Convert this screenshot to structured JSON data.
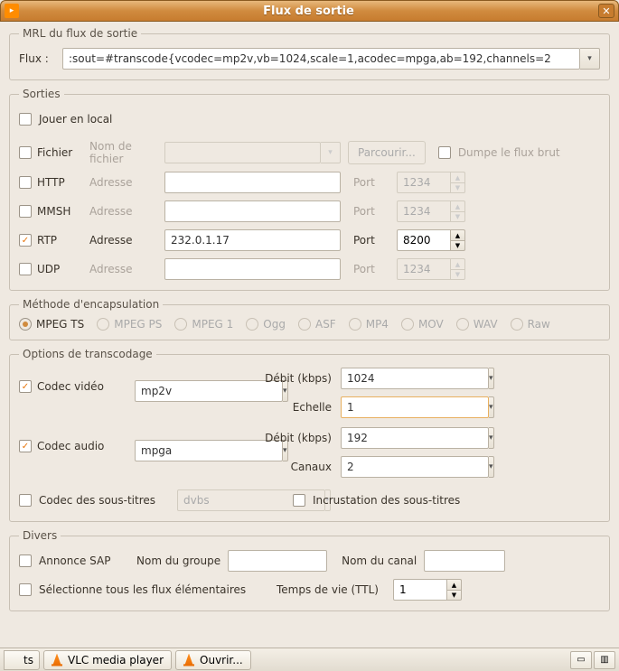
{
  "window": {
    "title": "Flux de sortie"
  },
  "mrl": {
    "legend": "MRL du flux de sortie",
    "flux_label": "Flux :",
    "value": ":sout=#transcode{vcodec=mp2v,vb=1024,scale=1,acodec=mpga,ab=192,channels=2"
  },
  "outputs": {
    "legend": "Sorties",
    "play_local": "Jouer en local",
    "file": "Fichier",
    "file_name_label": "Nom de fichier",
    "browse": "Parcourir...",
    "dump_raw": "Dumpe le flux brut",
    "http": "HTTP",
    "mmsh": "MMSH",
    "rtp": "RTP",
    "udp": "UDP",
    "address": "Adresse",
    "port": "Port",
    "http_port": "1234",
    "mmsh_port": "1234",
    "rtp_addr": "232.0.1.17",
    "rtp_port": "8200",
    "udp_port": "1234"
  },
  "encaps": {
    "legend": "Méthode d'encapsulation",
    "opts": [
      "MPEG TS",
      "MPEG PS",
      "MPEG 1",
      "Ogg",
      "ASF",
      "MP4",
      "MOV",
      "WAV",
      "Raw"
    ]
  },
  "transcode": {
    "legend": "Options de transcodage",
    "vcodec_label": "Codec vidéo",
    "vcodec": "mp2v",
    "bitrate_label": "Débit (kbps)",
    "vbitrate": "1024",
    "scale_label": "Echelle",
    "scale": "1",
    "acodec_label": "Codec audio",
    "acodec": "mpga",
    "abitrate": "192",
    "channels_label": "Canaux",
    "channels": "2",
    "scodec_label": "Codec des sous-titres",
    "scodec": "dvbs",
    "overlay": "Incrustation des sous-titres"
  },
  "misc": {
    "legend": "Divers",
    "sap": "Annonce SAP",
    "group_label": "Nom du groupe",
    "channel_label": "Nom du canal",
    "select_all": "Sélectionne tous les flux élémentaires",
    "ttl_label": "Temps de vie (TTL)",
    "ttl": "1"
  },
  "taskbar": {
    "frag": "ts",
    "vlc": "VLC media player",
    "open": "Ouvrir..."
  }
}
